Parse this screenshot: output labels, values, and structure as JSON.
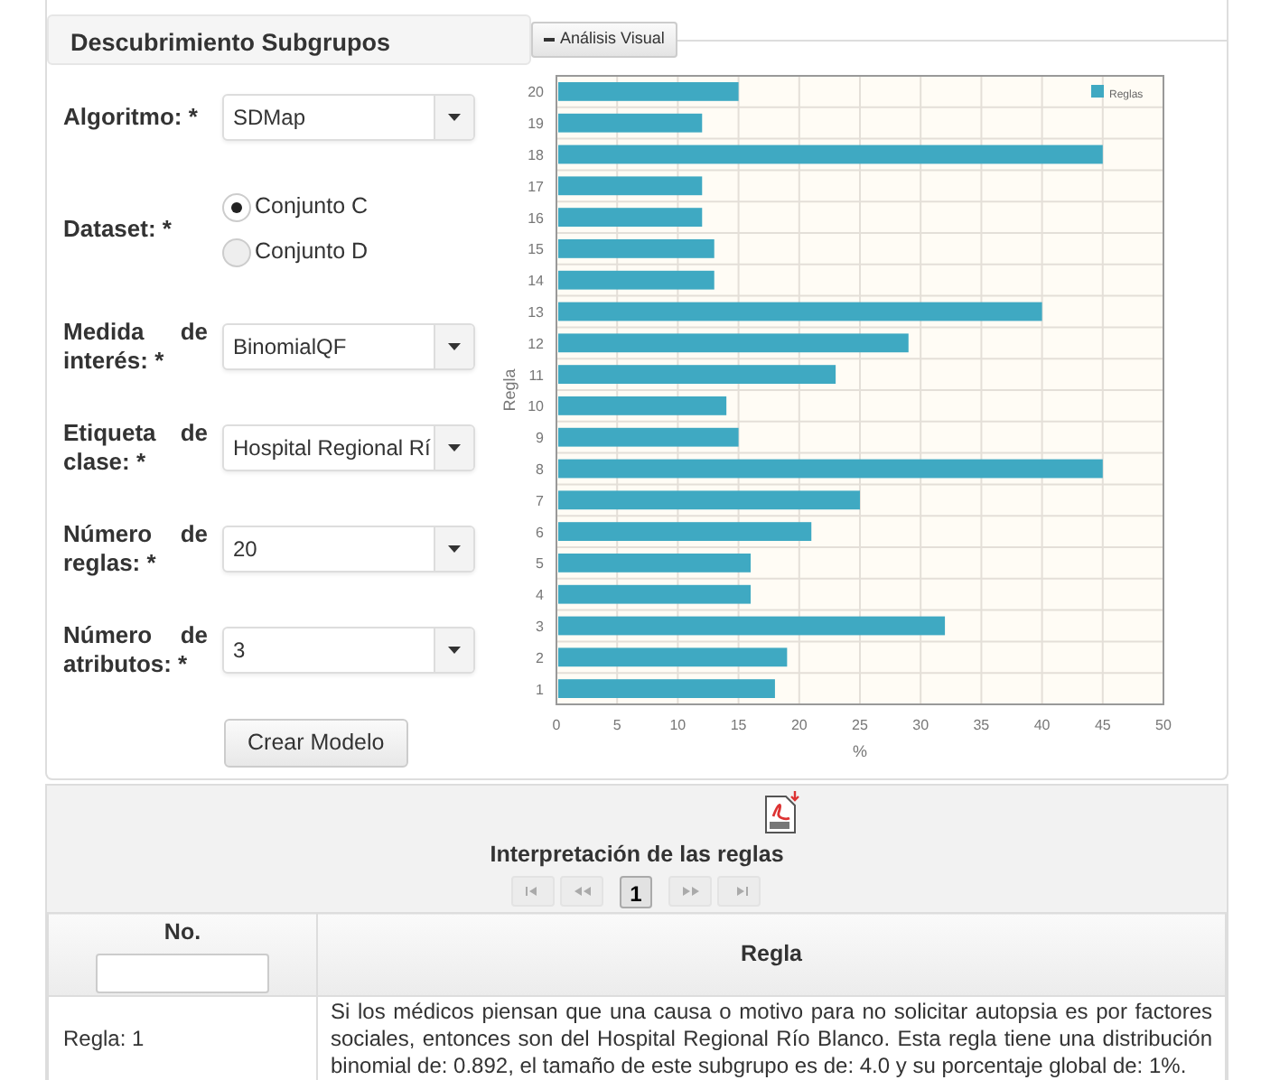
{
  "header": {
    "title": "Descubrimiento Subgrupos"
  },
  "visual_toggle": {
    "label": "Análisis Visual",
    "expanded": true
  },
  "form": {
    "fields": [
      {
        "kind": "select",
        "label": "Algoritmo: *",
        "value": "SDMap"
      },
      {
        "kind": "radio",
        "label": "Dataset: *",
        "options": [
          {
            "label": "Conjunto C",
            "selected": true
          },
          {
            "label": "Conjunto D",
            "selected": false
          }
        ]
      },
      {
        "kind": "select",
        "label": "Medida de interés: *",
        "value": "BinomialQF"
      },
      {
        "kind": "select",
        "label": "Etiqueta de clase: *",
        "value": "Hospital Regional Rí"
      },
      {
        "kind": "select",
        "label": "Número de reglas: *",
        "value": "20"
      },
      {
        "kind": "select",
        "label": "Número de atributos: *",
        "value": "3"
      }
    ],
    "submit": "Crear Modelo"
  },
  "chart_data": {
    "type": "bar",
    "orientation": "horizontal",
    "xlabel": "%",
    "ylabel": "Regla",
    "categories": [
      "20",
      "19",
      "18",
      "17",
      "16",
      "15",
      "14",
      "13",
      "12",
      "11",
      "10",
      "9",
      "8",
      "7",
      "6",
      "5",
      "4",
      "3",
      "2",
      "1"
    ],
    "series": [
      {
        "name": "Reglas",
        "color": "#3fa9c2",
        "values": [
          15,
          12,
          45,
          12,
          12,
          13,
          13,
          40,
          29,
          23,
          14,
          15,
          45,
          25,
          21,
          16,
          16,
          32,
          19,
          18
        ]
      }
    ],
    "grid": true,
    "xlim": [
      0,
      50
    ],
    "xticks": [
      0,
      5,
      10,
      15,
      20,
      25,
      30,
      35,
      40,
      45,
      50
    ]
  },
  "rules": {
    "title": "Interpretación de las reglas",
    "pagination": {
      "pages": [
        {
          "label": "1",
          "selected": true
        }
      ]
    },
    "columns": [
      {
        "label": "No.",
        "filter": true
      },
      {
        "label": "Regla",
        "filter": false
      }
    ],
    "rows": [
      {
        "number": "Regla: 1",
        "text": "Si los médicos piensan que una causa o motivo para no solicitar autopsia es por factores sociales, entonces son del Hospital Regional Río Blanco. Esta regla tiene una distribución binomial de: 0.892, el tamaño de este subgrupo es de: 4.0 y su porcentaje global de: 1%."
      }
    ]
  }
}
